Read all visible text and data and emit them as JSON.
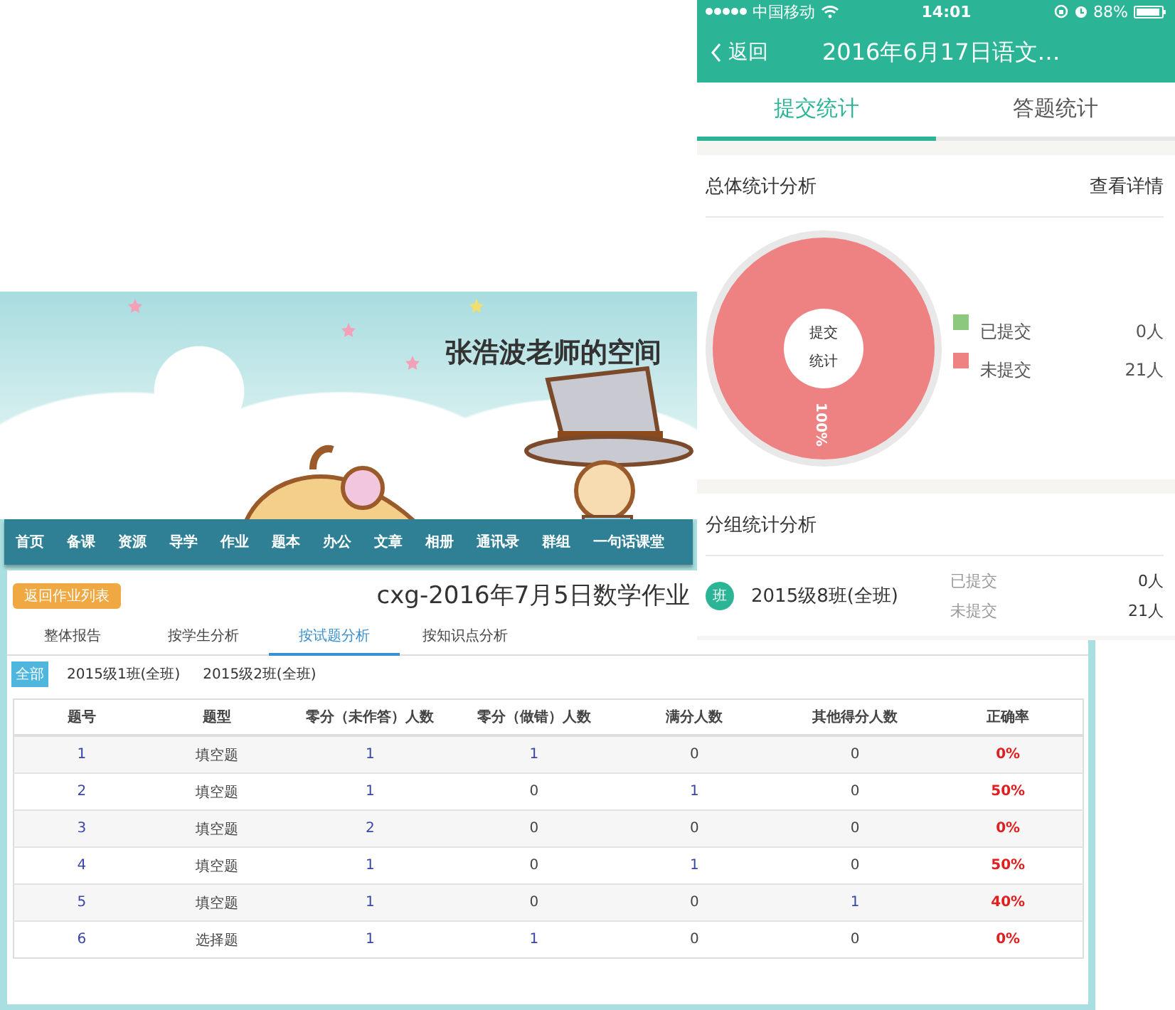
{
  "web": {
    "banner": {
      "title": "张浩波老师的空间"
    },
    "nav": [
      "首页",
      "备课",
      "资源",
      "导学",
      "作业",
      "题本",
      "办公",
      "文章",
      "相册",
      "通讯录",
      "群组",
      "一句话课堂"
    ],
    "back_button": "返回作业列表",
    "title": "cxg-2016年7月5日数学作业",
    "tabs": [
      {
        "label": "整体报告",
        "selected": false
      },
      {
        "label": "按学生分析",
        "selected": false
      },
      {
        "label": "按试题分析",
        "selected": true
      },
      {
        "label": "按知识点分析",
        "selected": false
      }
    ],
    "classes": [
      {
        "label": "全部",
        "selected": true
      },
      {
        "label": "2015级1班(全班)",
        "selected": false
      },
      {
        "label": "2015级2班(全班)",
        "selected": false
      }
    ],
    "table": {
      "columns": [
        {
          "label": "题号",
          "kind": "link"
        },
        {
          "label": "题型",
          "kind": "text"
        },
        {
          "label": "零分（未作答）人数",
          "kind": "count"
        },
        {
          "label": "零分（做错）人数",
          "kind": "count"
        },
        {
          "label": "满分人数",
          "kind": "count"
        },
        {
          "label": "其他得分人数",
          "kind": "count"
        },
        {
          "label": "正确率",
          "kind": "rate"
        }
      ],
      "rows": [
        {
          "cells": [
            "1",
            "填空题",
            "1",
            "1",
            "0",
            "0",
            "0%"
          ],
          "linked": [
            true,
            false,
            true,
            true,
            false,
            false,
            false
          ]
        },
        {
          "cells": [
            "2",
            "填空题",
            "1",
            "0",
            "1",
            "0",
            "50%"
          ],
          "linked": [
            true,
            false,
            true,
            false,
            true,
            false,
            false
          ]
        },
        {
          "cells": [
            "3",
            "填空题",
            "2",
            "0",
            "0",
            "0",
            "0%"
          ],
          "linked": [
            true,
            false,
            true,
            false,
            false,
            false,
            false
          ]
        },
        {
          "cells": [
            "4",
            "填空题",
            "1",
            "0",
            "1",
            "0",
            "50%"
          ],
          "linked": [
            true,
            false,
            true,
            false,
            true,
            false,
            false
          ]
        },
        {
          "cells": [
            "5",
            "填空题",
            "1",
            "0",
            "0",
            "1",
            "40%"
          ],
          "linked": [
            true,
            false,
            true,
            false,
            false,
            true,
            false
          ]
        },
        {
          "cells": [
            "6",
            "选择题",
            "1",
            "1",
            "0",
            "0",
            "0%"
          ],
          "linked": [
            true,
            false,
            true,
            true,
            false,
            false,
            false
          ]
        }
      ]
    }
  },
  "phone": {
    "status_bar": {
      "carrier": "中国移动",
      "time": "14:01",
      "battery": "88%"
    },
    "nav": {
      "back": "返回",
      "title": "2016年6月17日语文…"
    },
    "tabs": [
      {
        "label": "提交统计",
        "selected": true
      },
      {
        "label": "答题统计",
        "selected": false
      }
    ],
    "overall": {
      "title": "总体统计分析",
      "link": "查看详情",
      "chart_data": {
        "type": "pie",
        "title": "提交统计",
        "categories": [
          "已提交",
          "未提交"
        ],
        "values": [
          0,
          100
        ],
        "annotations": [
          "100%"
        ]
      },
      "legend": [
        {
          "count": "0人",
          "color": "#8cc97e"
        },
        {
          "count": "21人",
          "color": "#ee8282"
        }
      ]
    },
    "groups": {
      "title": "分组统计分析",
      "items": [
        {
          "badge": "班",
          "name": "2015级8班(全班)",
          "stats": [
            {
              "label": "已提交",
              "count": "0人"
            },
            {
              "label": "未提交",
              "count": "21人"
            }
          ]
        }
      ]
    }
  }
}
